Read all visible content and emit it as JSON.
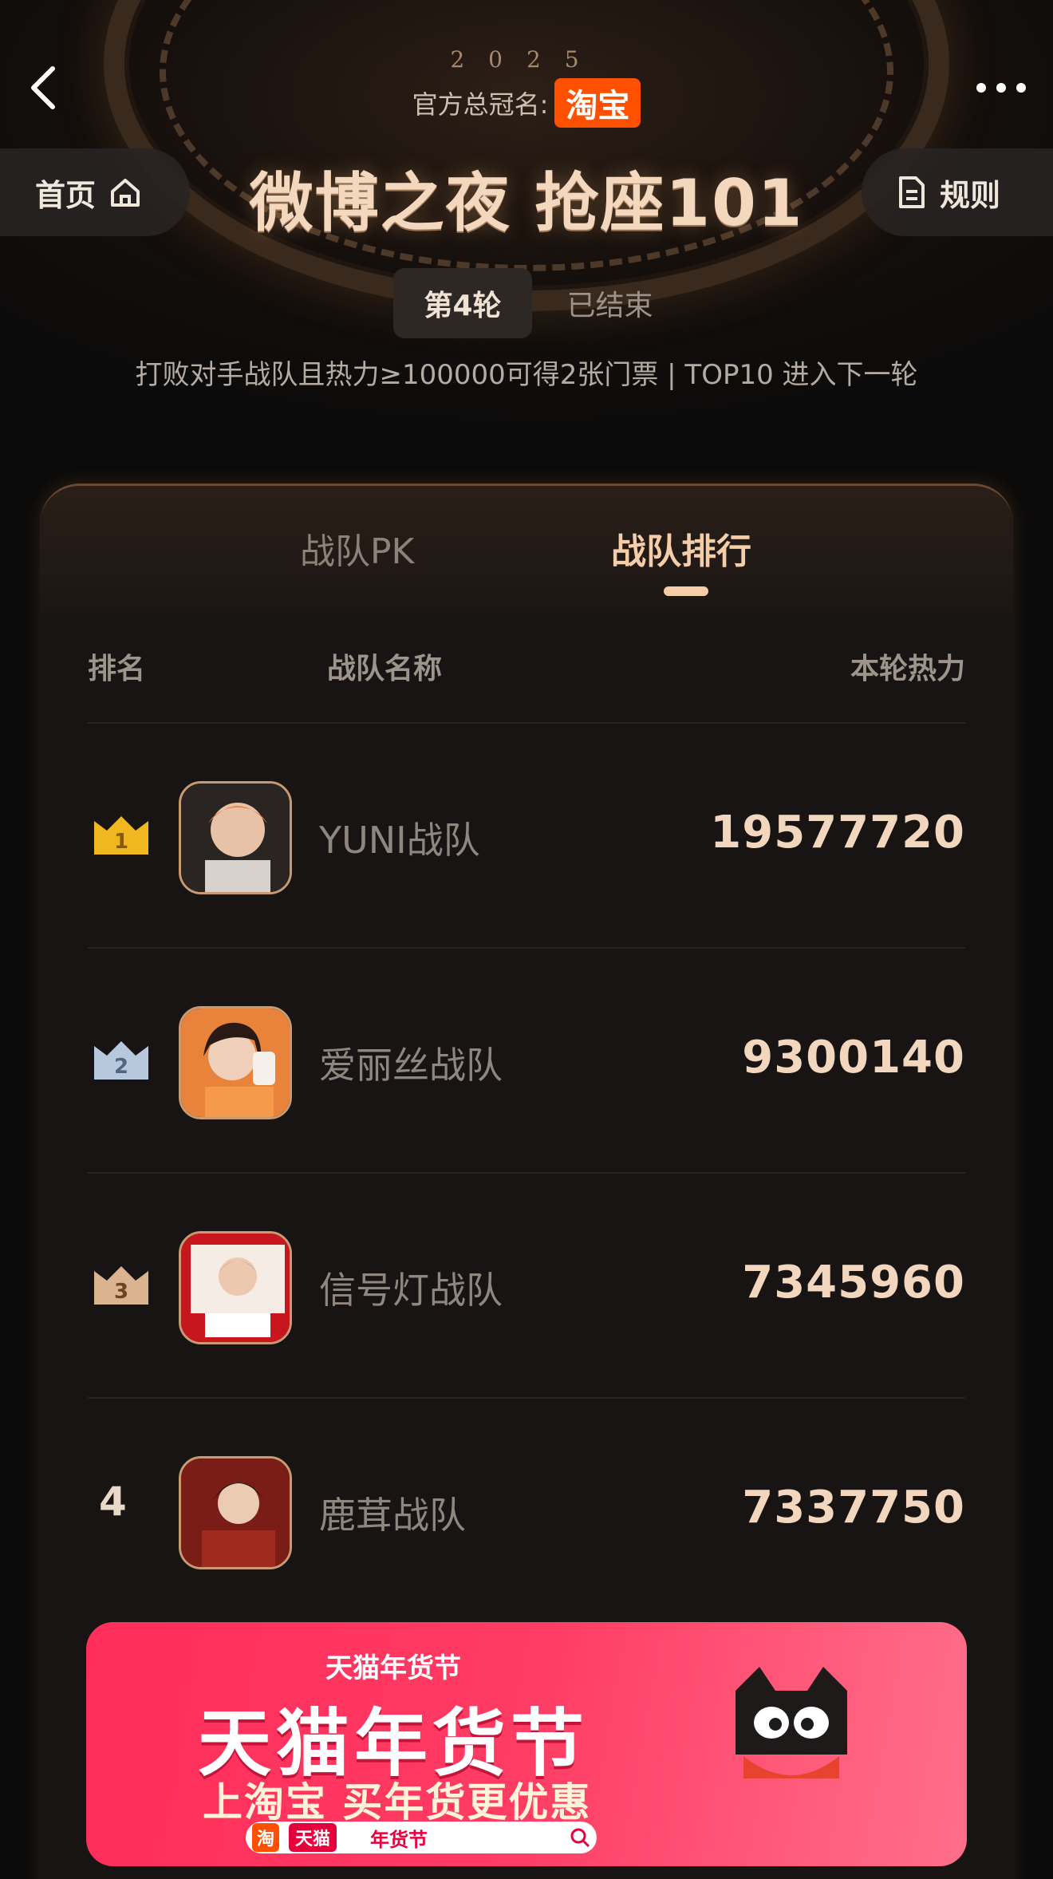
{
  "nav": {
    "year": "2025",
    "sponsor_label": "官方总冠名:",
    "sponsor_brand": "淘宝",
    "home_label": "首页",
    "rules_label": "规则"
  },
  "title": "微博之夜 抢座101",
  "round": {
    "current": "第4轮",
    "status": "已结束"
  },
  "rule_text": "打败对手战队且热力≥100000可得2张门票 | TOP10 进入下一轮",
  "tabs": [
    {
      "label": "战队PK",
      "active": false
    },
    {
      "label": "战队排行",
      "active": true
    }
  ],
  "table": {
    "headers": [
      "排名",
      "战队名称",
      "本轮热力"
    ],
    "rows": [
      {
        "rank": "1",
        "team": "YUNI战队",
        "heat": "19577720",
        "badge_color": "#f0b81e"
      },
      {
        "rank": "2",
        "team": "爱丽丝战队",
        "heat": "9300140",
        "badge_color": "#b8c8dc"
      },
      {
        "rank": "3",
        "team": "信号灯战队",
        "heat": "7345960",
        "badge_color": "#d9b48f"
      },
      {
        "rank": "4",
        "team": "鹿茸战队",
        "heat": "7337750",
        "badge_color": ""
      }
    ]
  },
  "banner": {
    "tag": "天猫年货节",
    "title": "天猫年货节",
    "subtitle": "上淘宝 买年货更优惠",
    "bar_taobao": "淘",
    "bar_tmall": "天猫",
    "bar_keyword": "年货节"
  },
  "colors": {
    "accent": "#f6cda9",
    "taobao": "#ff5000",
    "banner": "#ff2d5a"
  }
}
